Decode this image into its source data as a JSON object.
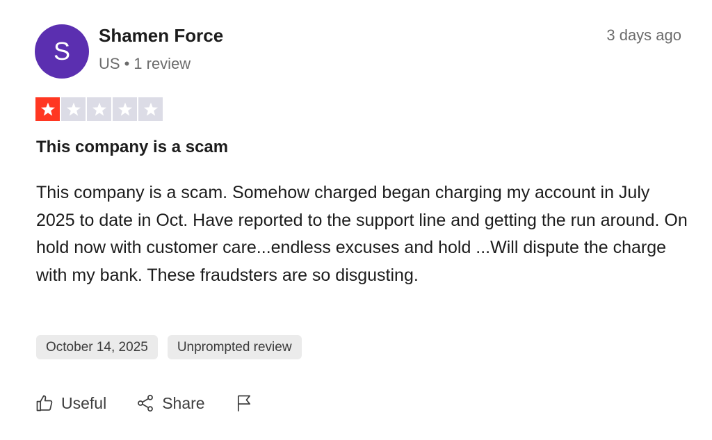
{
  "reviewer": {
    "initial": "S",
    "name": "Shamen Force",
    "country": "US",
    "separator": "•",
    "review_count": "1 review",
    "avatar_color": "#5b2fb0"
  },
  "review": {
    "date_ago": "3 days ago",
    "rating": 1,
    "rating_max": 5,
    "title": "This company is a scam",
    "body": "This company is a scam. Somehow charged began charging my account in July 2025 to date in Oct. Have reported to the support line and getting the run around. On hold now with customer care...endless excuses and hold ...Will dispute the charge with my bank. These fraudsters are so disgusting.",
    "tags": {
      "date": "October 14, 2025",
      "type": "Unprompted review"
    }
  },
  "actions": {
    "useful_label": "Useful",
    "share_label": "Share",
    "flag_icon": "flag-icon"
  },
  "colors": {
    "star_filled": "#ff3722",
    "star_empty": "#dcdce6",
    "tag_bg": "#ebebeb"
  }
}
